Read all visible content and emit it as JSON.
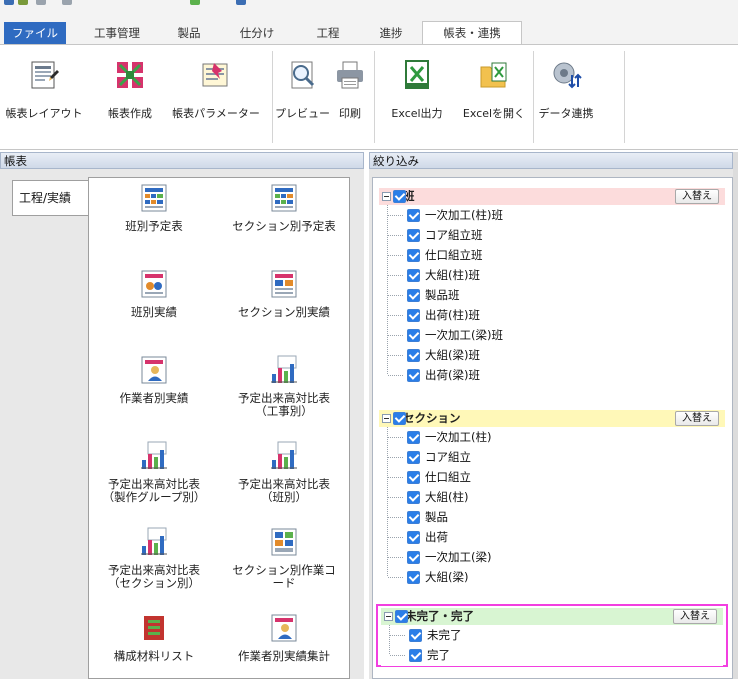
{
  "tabs": [
    "ファイル",
    "工事管理",
    "製品",
    "仕分け",
    "工程",
    "進捗",
    "帳表・連携"
  ],
  "active_tab_index": 6,
  "ribbon_buttons": [
    {
      "label": "帳表レイアウト",
      "icon": "report-layout-icon"
    },
    {
      "label": "帳表作成",
      "icon": "report-create-icon"
    },
    {
      "label": "帳表パラメーター",
      "icon": "report-parameter-icon"
    },
    {
      "label": "プレビュー",
      "icon": "preview-icon"
    },
    {
      "label": "印刷",
      "icon": "printer-icon"
    },
    {
      "label": "Excel出力",
      "icon": "excel-output-icon"
    },
    {
      "label": "Excelを開く",
      "icon": "excel-open-icon"
    },
    {
      "label": "データ連携",
      "icon": "data-link-icon"
    }
  ],
  "left_pane": {
    "header": "帳表",
    "vertical_tab": "工程/実績",
    "reports": [
      {
        "label": "班別予定表",
        "icon": "schedule-report-icon"
      },
      {
        "label": "セクション別予定表",
        "icon": "schedule-report-icon"
      },
      {
        "label": "班別実績",
        "icon": "group-results-icon"
      },
      {
        "label": "セクション別実績",
        "icon": "section-results-icon"
      },
      {
        "label": "作業者別実績",
        "icon": "worker-results-icon"
      },
      {
        "label": "予定出来高対比表\n（工事別）",
        "icon": "comparison-chart-icon"
      },
      {
        "label": "予定出来高対比表\n（製作グループ別）",
        "icon": "comparison-chart-icon"
      },
      {
        "label": "予定出来高対比表\n（班別）",
        "icon": "comparison-chart-icon"
      },
      {
        "label": "予定出来高対比表\n（セクション別）",
        "icon": "comparison-chart-icon"
      },
      {
        "label": "セクション別作業コ\nード",
        "icon": "work-code-icon"
      },
      {
        "label": "構成材料リスト",
        "icon": "materials-list-icon"
      },
      {
        "label": "作業者別実績集計",
        "icon": "worker-summary-icon"
      }
    ]
  },
  "right_pane": {
    "header": "絞り込み",
    "swap_label": "入替え",
    "groups": [
      {
        "title": "班",
        "color": "#fcdcdc",
        "items": [
          "一次加工(柱)班",
          "コア組立班",
          "仕口組立班",
          "大組(柱)班",
          "製品班",
          "出荷(柱)班",
          "一次加工(梁)班",
          "大組(梁)班",
          "出荷(梁)班"
        ]
      },
      {
        "title": "セクション",
        "color": "#fff8b8",
        "items": [
          "一次加工(柱)",
          "コア組立",
          "仕口組立",
          "大組(柱)",
          "製品",
          "出荷",
          "一次加工(梁)",
          "大組(梁)"
        ]
      },
      {
        "title": "未完了・完了",
        "color": "#d8f5d2",
        "items": [
          "未完了",
          "完了"
        ]
      }
    ],
    "highlight_color": "#f23fe0"
  },
  "colors": {
    "file_tab": "#2f6bc1",
    "checkbox": "#2a7ee8"
  }
}
